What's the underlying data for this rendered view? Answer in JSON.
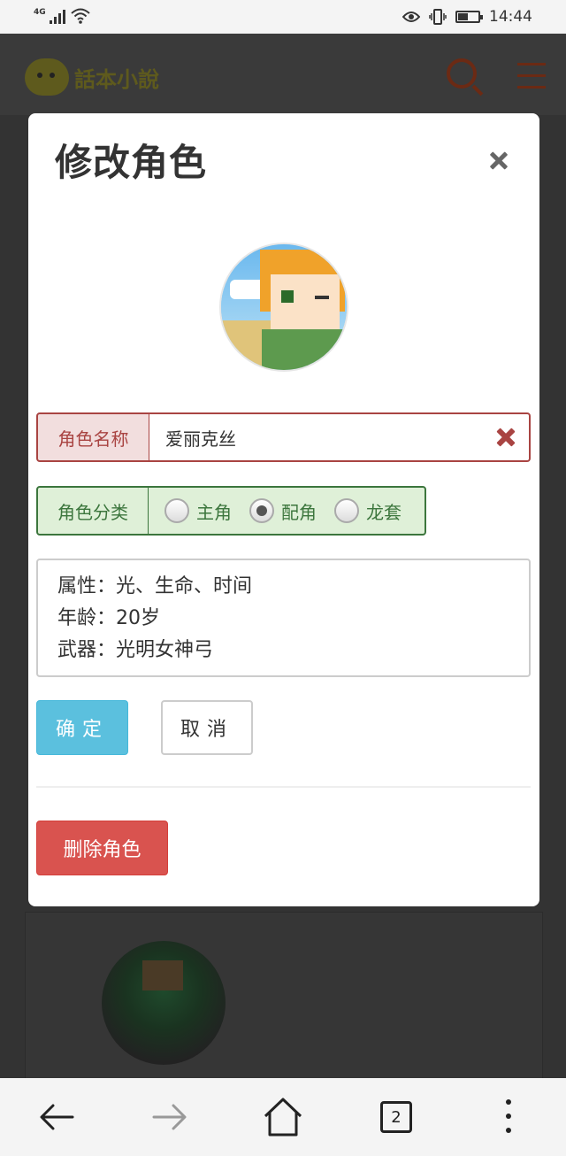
{
  "status_bar": {
    "network": "4G",
    "time": "14:44"
  },
  "background_page": {
    "logo_text": "話本小說"
  },
  "modal": {
    "title": "修改角色",
    "name_label": "角色名称",
    "name_value": "爱丽克丝",
    "category_label": "角色分类",
    "category_options": [
      "主角",
      "配角",
      "龙套"
    ],
    "category_selected": "配角",
    "description_lines": [
      "属性：光、生命、时间",
      "年龄：20岁",
      "武器：光明女神弓"
    ],
    "confirm_label": "确定",
    "cancel_label": "取消",
    "delete_label": "删除角色"
  },
  "nav_bar": {
    "tab_count": "2"
  },
  "colors": {
    "danger": "#a94442",
    "success": "#3c763d",
    "info": "#5bc0de",
    "delete": "#d9534f"
  }
}
